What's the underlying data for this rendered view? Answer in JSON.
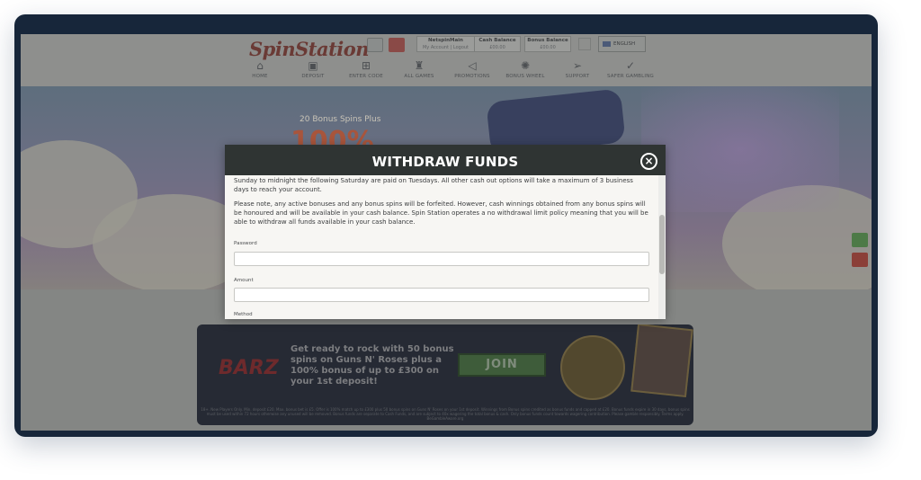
{
  "site": {
    "logo": "SpinStation",
    "account": {
      "username_label": "NetspinMain",
      "username_links": "My Account | Logout",
      "cash_label": "Cash Balance",
      "cash_value": "£00.00",
      "bonus_label": "Bonus Balance",
      "bonus_value": "£00.00"
    },
    "language": "ENGLISH",
    "nav": [
      {
        "label": "HOME",
        "icon": "home-icon"
      },
      {
        "label": "DEPOSIT",
        "icon": "deposit-icon"
      },
      {
        "label": "ENTER CODE",
        "icon": "code-icon"
      },
      {
        "label": "ALL GAMES",
        "icon": "games-icon"
      },
      {
        "label": "PROMOTIONS",
        "icon": "megaphone-icon"
      },
      {
        "label": "BONUS WHEEL",
        "icon": "wheel-icon"
      },
      {
        "label": "SUPPORT",
        "icon": "paper-plane-icon"
      },
      {
        "label": "SAFER GAMBLING",
        "icon": "shield-check-icon"
      }
    ]
  },
  "hero": {
    "small_text": "20 Bonus Spins Plus",
    "big_text": "100%"
  },
  "promo": {
    "logo": "BARZ",
    "headline": "Get ready to rock with 50 bonus spins on Guns N' Roses plus a 100% bonus of up to £300 on your 1st deposit!",
    "cta": "JOIN",
    "fine_print": "18+. New Players Only. Min. deposit £20. Max. bonus bet is £5. Offer is 100% match up to £300 plus 50 bonus spins on Guns N' Roses on your 1st deposit. Winnings from Bonus spins credited as bonus funds and capped at £20. Bonus funds expire in 30 days, bonus spins must be used within 72 hours otherwise any unused will be removed. Bonus funds are separate to Cash Funds, and are subject to 40x wagering the total bonus & cash. Only bonus funds count towards wagering contribution. Please gamble responsibly. Terms apply. BeGambleAware.org"
  },
  "modal": {
    "title": "WITHDRAW FUNDS",
    "close_symbol": "×",
    "paragraph_1": "Sunday to midnight the following Saturday are paid on Tuesdays. All other cash out options will take a maximum of 3 business days to reach your account.",
    "paragraph_2": "Please note, any active bonuses and any bonus spins will be forfeited. However, cash winnings obtained from any bonus spins will be honoured and will be available in your cash balance. Spin Station operates a no withdrawal limit policy meaning that you will be able to withdraw all funds available in your cash balance.",
    "password_label": "Password",
    "password_value": "",
    "amount_label": "Amount",
    "amount_value": "",
    "method_label": "Method"
  }
}
